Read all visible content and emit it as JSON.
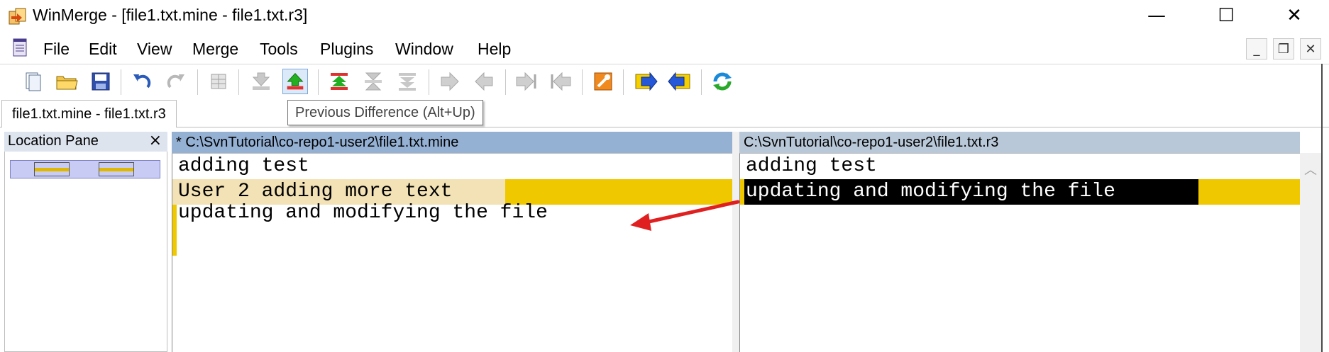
{
  "window": {
    "title": "WinMerge - [file1.txt.mine - file1.txt.r3]",
    "controls": {
      "minimize": "—",
      "maximize": "☐",
      "close": "✕"
    }
  },
  "menu": {
    "items": [
      "File",
      "Edit",
      "View",
      "Merge",
      "Tools",
      "Plugins",
      "Window",
      "Help"
    ],
    "mdi_controls": {
      "minimize": "_",
      "restore": "❐",
      "close": "✕"
    }
  },
  "toolbar": {
    "icons": [
      "new-icon",
      "open-folder-icon",
      "save-icon",
      "undo-icon",
      "redo-icon",
      "diff-context-icon",
      "next-diff-icon",
      "previous-diff-icon",
      "first-diff-icon",
      "current-diff-icon",
      "last-diff-icon",
      "copy-right-icon",
      "copy-left-icon",
      "copy-right-advance-icon",
      "copy-left-advance-icon",
      "options-icon",
      "next-file-icon",
      "previous-file-icon",
      "refresh-icon"
    ],
    "tooltip": "Previous Difference (Alt+Up)"
  },
  "tabs": [
    {
      "label": "file1.txt.mine - file1.txt.r3"
    }
  ],
  "location_pane": {
    "title": "Location Pane",
    "close": "×"
  },
  "left_pane": {
    "path": "* C:\\SvnTutorial\\co-repo1-user2\\file1.txt.mine",
    "lines": [
      "adding test",
      "User 2 adding more text",
      "updating and modifying the file"
    ]
  },
  "right_pane": {
    "path": "C:\\SvnTutorial\\co-repo1-user2\\file1.txt.r3",
    "lines": [
      "adding test",
      "updating and modifying the file"
    ]
  },
  "colors": {
    "diff_highlight": "#f0c800",
    "diff_text_bg": "#f2e2b6",
    "selected_bg": "#000000",
    "left_header": "#94b0d3",
    "right_header": "#b9c8d8",
    "arrow": "#e02020"
  }
}
